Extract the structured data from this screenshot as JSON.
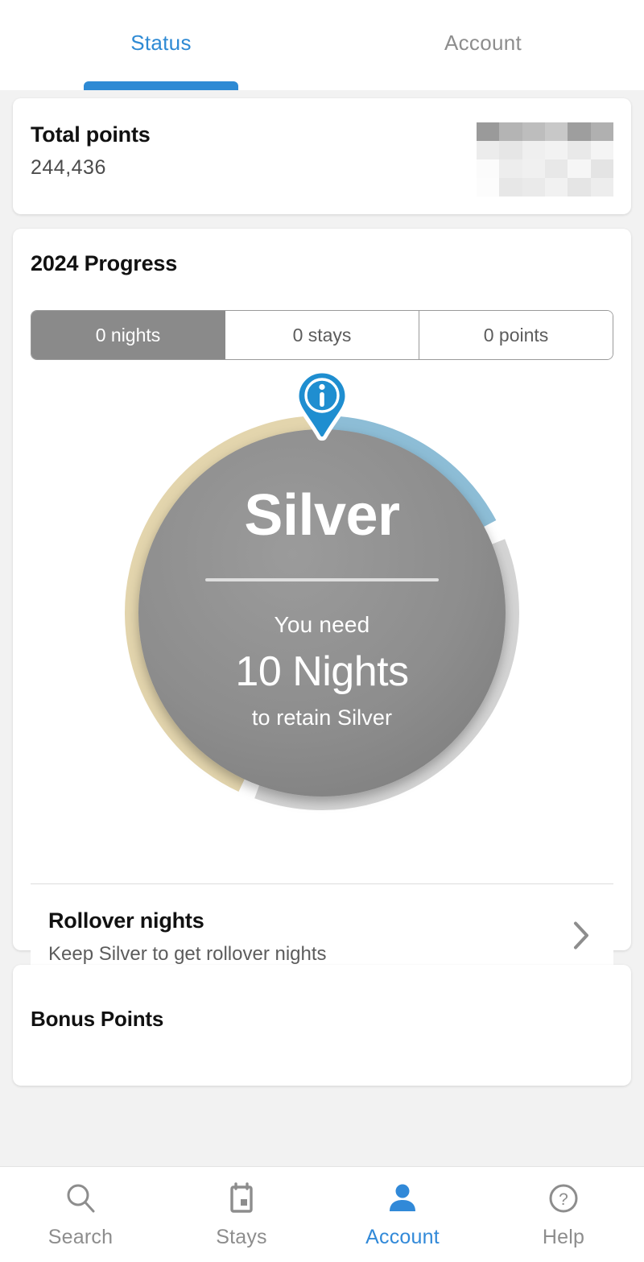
{
  "top_tabs": [
    {
      "label": "Status",
      "active": true
    },
    {
      "label": "Account",
      "active": false
    }
  ],
  "total_points_card": {
    "title": "Total points",
    "value": "244,436",
    "redacted_note": "redacted-mosaic"
  },
  "progress_card": {
    "title": "2024 Progress",
    "segments": [
      {
        "label": "0 nights",
        "selected": true
      },
      {
        "label": "0 stays",
        "selected": false
      },
      {
        "label": "0 points",
        "selected": false
      }
    ],
    "info_icon": "info-pin-icon",
    "ring": {
      "tier": "Silver",
      "need_label": "You need",
      "need_value": "10 Nights",
      "need_sub": "to retain Silver"
    }
  },
  "rollover": {
    "title": "Rollover nights",
    "subtitle": "Keep Silver to get rollover nights",
    "chevron": "chevron-right-icon"
  },
  "bonus_card": {
    "title": "Bonus Points"
  },
  "bottom_nav": [
    {
      "label": "Search",
      "icon": "search-icon",
      "active": false
    },
    {
      "label": "Stays",
      "icon": "calendar-icon",
      "active": false
    },
    {
      "label": "Account",
      "icon": "person-icon",
      "active": true
    },
    {
      "label": "Help",
      "icon": "help-circle-icon",
      "active": false
    }
  ],
  "colors": {
    "accent_blue": "#2e8ad4",
    "nav_active_blue": "#3189d8",
    "ring_gold": "#e3d5ad",
    "ring_blue": "#8dbdd6",
    "ring_gray": "#d4d4d4",
    "ring_fill": "#8c8c8c",
    "segment_selected": "#8a8a8a",
    "page_bg": "#f2f2f2",
    "card_bg": "#ffffff"
  },
  "chart_data": {
    "type": "pie",
    "title": "2024 Progress status ring",
    "subtitle": "Silver tier retention ring",
    "center_text": [
      "Silver",
      "You need",
      "10 Nights",
      "to retain Silver"
    ],
    "unit": "degrees",
    "total_degrees": 360,
    "segments": [
      {
        "name": "Gold (prior tier track)",
        "color": "#e3d5ad",
        "start_deg": 0,
        "end_deg": -155,
        "sweep_deg": 155
      },
      {
        "name": "Blue (earned progress)",
        "color": "#8dbdd6",
        "start_deg": 0,
        "end_deg": 62,
        "sweep_deg": 62
      },
      {
        "name": "Gray (remaining)",
        "color": "#d4d4d4",
        "start_deg": 68,
        "end_deg": 200,
        "sweep_deg": 132
      }
    ],
    "legend": [],
    "grid": false
  }
}
